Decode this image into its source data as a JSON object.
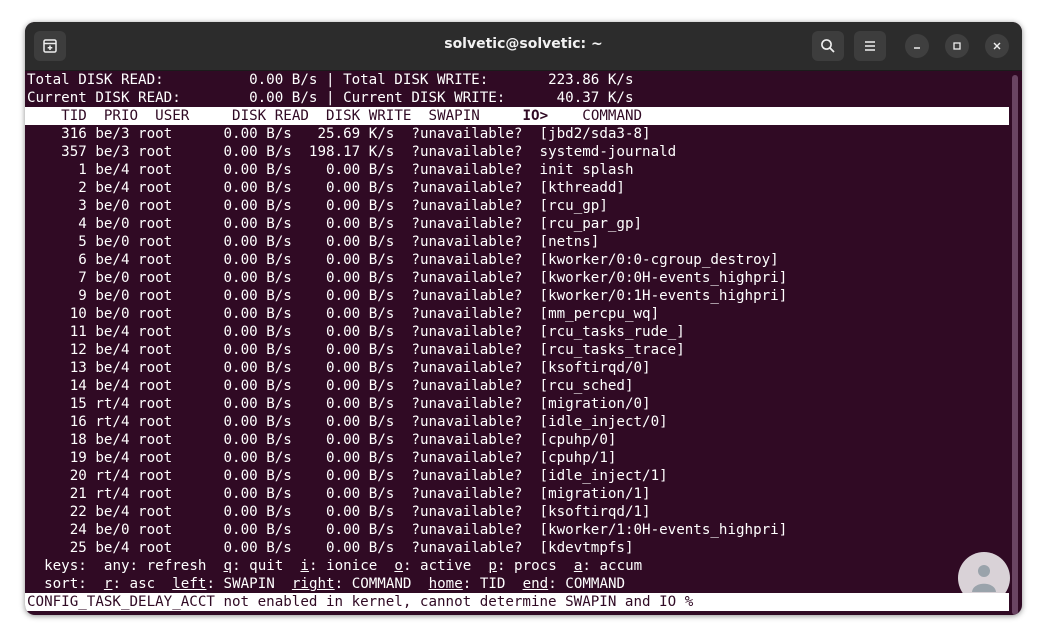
{
  "window": {
    "title": "solvetic@solvetic: ~"
  },
  "summary": {
    "total_read_label": "Total DISK READ:",
    "total_read_value": "0.00 B/s",
    "total_write_label": "Total DISK WRITE:",
    "total_write_value": "223.86 K/s",
    "current_read_label": "Current DISK READ:",
    "current_read_value": "0.00 B/s",
    "current_write_label": "Current DISK WRITE:",
    "current_write_value": "40.37 K/s"
  },
  "table": {
    "headers": {
      "tid": "TID",
      "prio": "PRIO",
      "user": "USER",
      "disk_read": "DISK READ",
      "disk_write": "DISK WRITE",
      "swapin": "SWAPIN",
      "io": "IO>",
      "command": "COMMAND"
    },
    "rows": [
      {
        "tid": "316",
        "prio": "be/3",
        "user": "root",
        "read": "0.00 B/s",
        "write": "25.69 K/s",
        "swapin": "?unavailable?",
        "command": "[jbd2/sda3-8]"
      },
      {
        "tid": "357",
        "prio": "be/3",
        "user": "root",
        "read": "0.00 B/s",
        "write": "198.17 K/s",
        "swapin": "?unavailable?",
        "command": "systemd-journald"
      },
      {
        "tid": "1",
        "prio": "be/4",
        "user": "root",
        "read": "0.00 B/s",
        "write": "0.00 B/s",
        "swapin": "?unavailable?",
        "command": "init splash"
      },
      {
        "tid": "2",
        "prio": "be/4",
        "user": "root",
        "read": "0.00 B/s",
        "write": "0.00 B/s",
        "swapin": "?unavailable?",
        "command": "[kthreadd]"
      },
      {
        "tid": "3",
        "prio": "be/0",
        "user": "root",
        "read": "0.00 B/s",
        "write": "0.00 B/s",
        "swapin": "?unavailable?",
        "command": "[rcu_gp]"
      },
      {
        "tid": "4",
        "prio": "be/0",
        "user": "root",
        "read": "0.00 B/s",
        "write": "0.00 B/s",
        "swapin": "?unavailable?",
        "command": "[rcu_par_gp]"
      },
      {
        "tid": "5",
        "prio": "be/0",
        "user": "root",
        "read": "0.00 B/s",
        "write": "0.00 B/s",
        "swapin": "?unavailable?",
        "command": "[netns]"
      },
      {
        "tid": "6",
        "prio": "be/4",
        "user": "root",
        "read": "0.00 B/s",
        "write": "0.00 B/s",
        "swapin": "?unavailable?",
        "command": "[kworker/0:0-cgroup_destroy]"
      },
      {
        "tid": "7",
        "prio": "be/0",
        "user": "root",
        "read": "0.00 B/s",
        "write": "0.00 B/s",
        "swapin": "?unavailable?",
        "command": "[kworker/0:0H-events_highpri]"
      },
      {
        "tid": "9",
        "prio": "be/0",
        "user": "root",
        "read": "0.00 B/s",
        "write": "0.00 B/s",
        "swapin": "?unavailable?",
        "command": "[kworker/0:1H-events_highpri]"
      },
      {
        "tid": "10",
        "prio": "be/0",
        "user": "root",
        "read": "0.00 B/s",
        "write": "0.00 B/s",
        "swapin": "?unavailable?",
        "command": "[mm_percpu_wq]"
      },
      {
        "tid": "11",
        "prio": "be/4",
        "user": "root",
        "read": "0.00 B/s",
        "write": "0.00 B/s",
        "swapin": "?unavailable?",
        "command": "[rcu_tasks_rude_]"
      },
      {
        "tid": "12",
        "prio": "be/4",
        "user": "root",
        "read": "0.00 B/s",
        "write": "0.00 B/s",
        "swapin": "?unavailable?",
        "command": "[rcu_tasks_trace]"
      },
      {
        "tid": "13",
        "prio": "be/4",
        "user": "root",
        "read": "0.00 B/s",
        "write": "0.00 B/s",
        "swapin": "?unavailable?",
        "command": "[ksoftirqd/0]"
      },
      {
        "tid": "14",
        "prio": "be/4",
        "user": "root",
        "read": "0.00 B/s",
        "write": "0.00 B/s",
        "swapin": "?unavailable?",
        "command": "[rcu_sched]"
      },
      {
        "tid": "15",
        "prio": "rt/4",
        "user": "root",
        "read": "0.00 B/s",
        "write": "0.00 B/s",
        "swapin": "?unavailable?",
        "command": "[migration/0]"
      },
      {
        "tid": "16",
        "prio": "rt/4",
        "user": "root",
        "read": "0.00 B/s",
        "write": "0.00 B/s",
        "swapin": "?unavailable?",
        "command": "[idle_inject/0]"
      },
      {
        "tid": "18",
        "prio": "be/4",
        "user": "root",
        "read": "0.00 B/s",
        "write": "0.00 B/s",
        "swapin": "?unavailable?",
        "command": "[cpuhp/0]"
      },
      {
        "tid": "19",
        "prio": "be/4",
        "user": "root",
        "read": "0.00 B/s",
        "write": "0.00 B/s",
        "swapin": "?unavailable?",
        "command": "[cpuhp/1]"
      },
      {
        "tid": "20",
        "prio": "rt/4",
        "user": "root",
        "read": "0.00 B/s",
        "write": "0.00 B/s",
        "swapin": "?unavailable?",
        "command": "[idle_inject/1]"
      },
      {
        "tid": "21",
        "prio": "rt/4",
        "user": "root",
        "read": "0.00 B/s",
        "write": "0.00 B/s",
        "swapin": "?unavailable?",
        "command": "[migration/1]"
      },
      {
        "tid": "22",
        "prio": "be/4",
        "user": "root",
        "read": "0.00 B/s",
        "write": "0.00 B/s",
        "swapin": "?unavailable?",
        "command": "[ksoftirqd/1]"
      },
      {
        "tid": "24",
        "prio": "be/0",
        "user": "root",
        "read": "0.00 B/s",
        "write": "0.00 B/s",
        "swapin": "?unavailable?",
        "command": "[kworker/1:0H-events_highpri]"
      },
      {
        "tid": "25",
        "prio": "be/4",
        "user": "root",
        "read": "0.00 B/s",
        "write": "0.00 B/s",
        "swapin": "?unavailable?",
        "command": "[kdevtmpfs]"
      }
    ]
  },
  "keys": {
    "keys_label": "keys:",
    "any_key": "any",
    "any_action": "refresh",
    "q_key": "q",
    "q_action": "quit",
    "i_key": "i",
    "i_action": "ionice",
    "o_key": "o",
    "o_action": "active",
    "p_key": "p",
    "p_action": "procs",
    "a_key": "a",
    "a_action": "accum",
    "sort_label": "sort:",
    "r_key": "r",
    "r_action": "asc",
    "left_key": "left",
    "left_action": "SWAPIN",
    "right_key": "right",
    "right_action": "COMMAND",
    "home_key": "home",
    "home_action": "TID",
    "end_key": "end",
    "end_action": "COMMAND"
  },
  "status_message": "CONFIG_TASK_DELAY_ACCT not enabled in kernel, cannot determine SWAPIN and IO %",
  "colors": {
    "terminal_bg": "#300a24",
    "titlebar_bg": "#2c2c2c",
    "text": "#ffffff"
  },
  "icons": {
    "new_tab": "new-tab-icon",
    "search": "search-icon",
    "menu": "hamburger-menu-icon",
    "minimize": "minimize-icon",
    "maximize": "maximize-icon",
    "close": "close-icon"
  }
}
